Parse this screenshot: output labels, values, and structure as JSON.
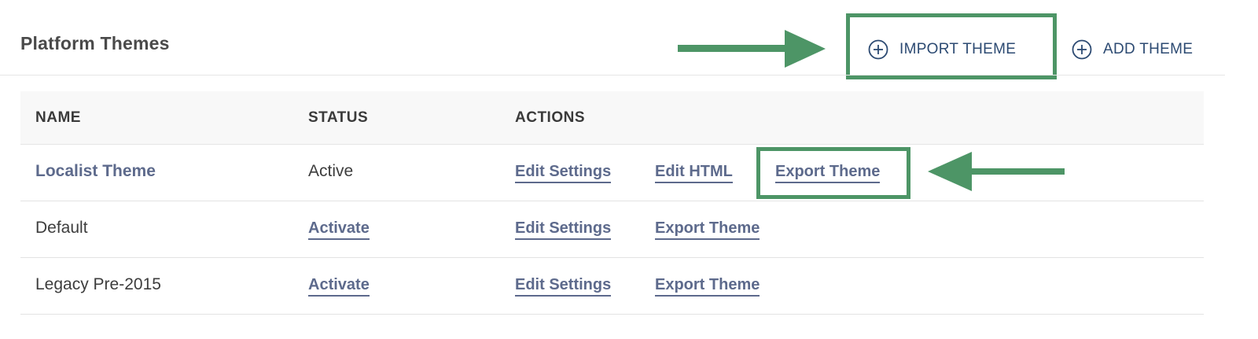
{
  "header": {
    "title": "Platform Themes",
    "import_button": "IMPORT THEME",
    "add_button": "ADD THEME",
    "icon": "plus-circle-icon"
  },
  "table": {
    "columns": [
      "NAME",
      "STATUS",
      "ACTIONS"
    ],
    "rows": [
      {
        "name": "Localist Theme",
        "status": "Active",
        "actions": [
          "Edit Settings",
          "Edit HTML",
          "Export Theme"
        ]
      },
      {
        "name": "Default",
        "status": "Activate",
        "actions": [
          "Edit Settings",
          "Export Theme"
        ]
      },
      {
        "name": "Legacy Pre-2015",
        "status": "Activate",
        "actions": [
          "Edit Settings",
          "Export Theme"
        ]
      }
    ]
  },
  "annotations": {
    "highlight_color": "#4d9566",
    "arrow_icon": "arrow-icon"
  },
  "colors": {
    "link": "#5d6a8c",
    "header_button": "#2c4a72"
  }
}
